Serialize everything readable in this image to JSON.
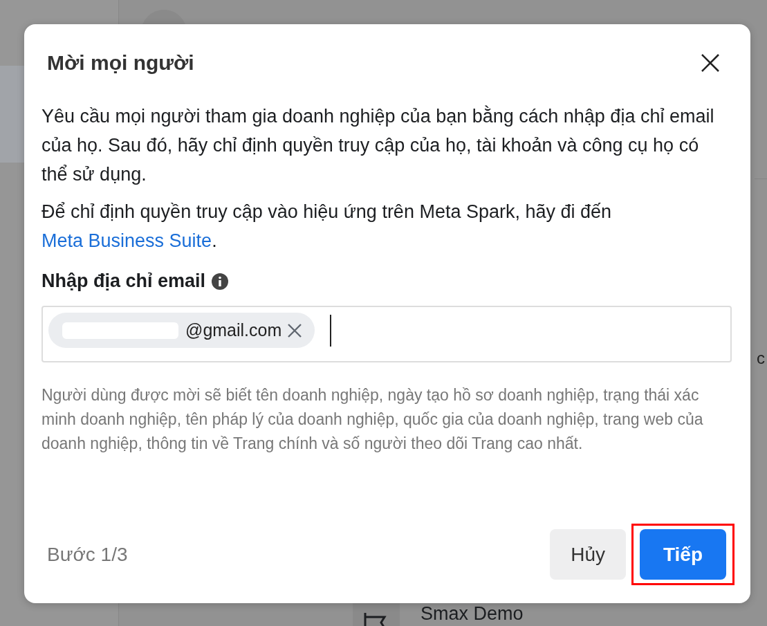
{
  "background": {
    "column_text": "c",
    "page_name": "Smax Demo"
  },
  "dialog": {
    "title": "Mời mọi người",
    "intro": "Yêu cầu mọi người tham gia doanh nghiệp của bạn bằng cách nhập địa chỉ email của họ. Sau đó, hãy chỉ định quyền truy cập của họ, tài khoản và công cụ họ có thể sử dụng.",
    "spark_note": {
      "text": "Để chỉ định quyền truy cập vào hiệu ứng trên Meta Spark, hãy đi đến ",
      "link": "Meta Business Suite",
      "after": "."
    },
    "email_label": "Nhập địa chỉ email",
    "email_chips": [
      {
        "text": "@gmail.com",
        "redacted": true
      }
    ],
    "notice": "Người dùng được mời sẽ biết tên doanh nghiệp, ngày tạo hồ sơ doanh nghiệp, trạng thái xác minh doanh nghiệp, tên pháp lý của doanh nghiệp, quốc gia của doanh nghiệp, trang web của doanh nghiệp, thông tin về Trang chính và số người theo dõi Trang cao nhất.",
    "step": "Bước 1/3",
    "buttons": [
      {
        "label": "Hủy",
        "kind": "secondary",
        "highlighted": false
      },
      {
        "label": "Tiếp",
        "kind": "primary",
        "highlighted": true
      }
    ]
  }
}
